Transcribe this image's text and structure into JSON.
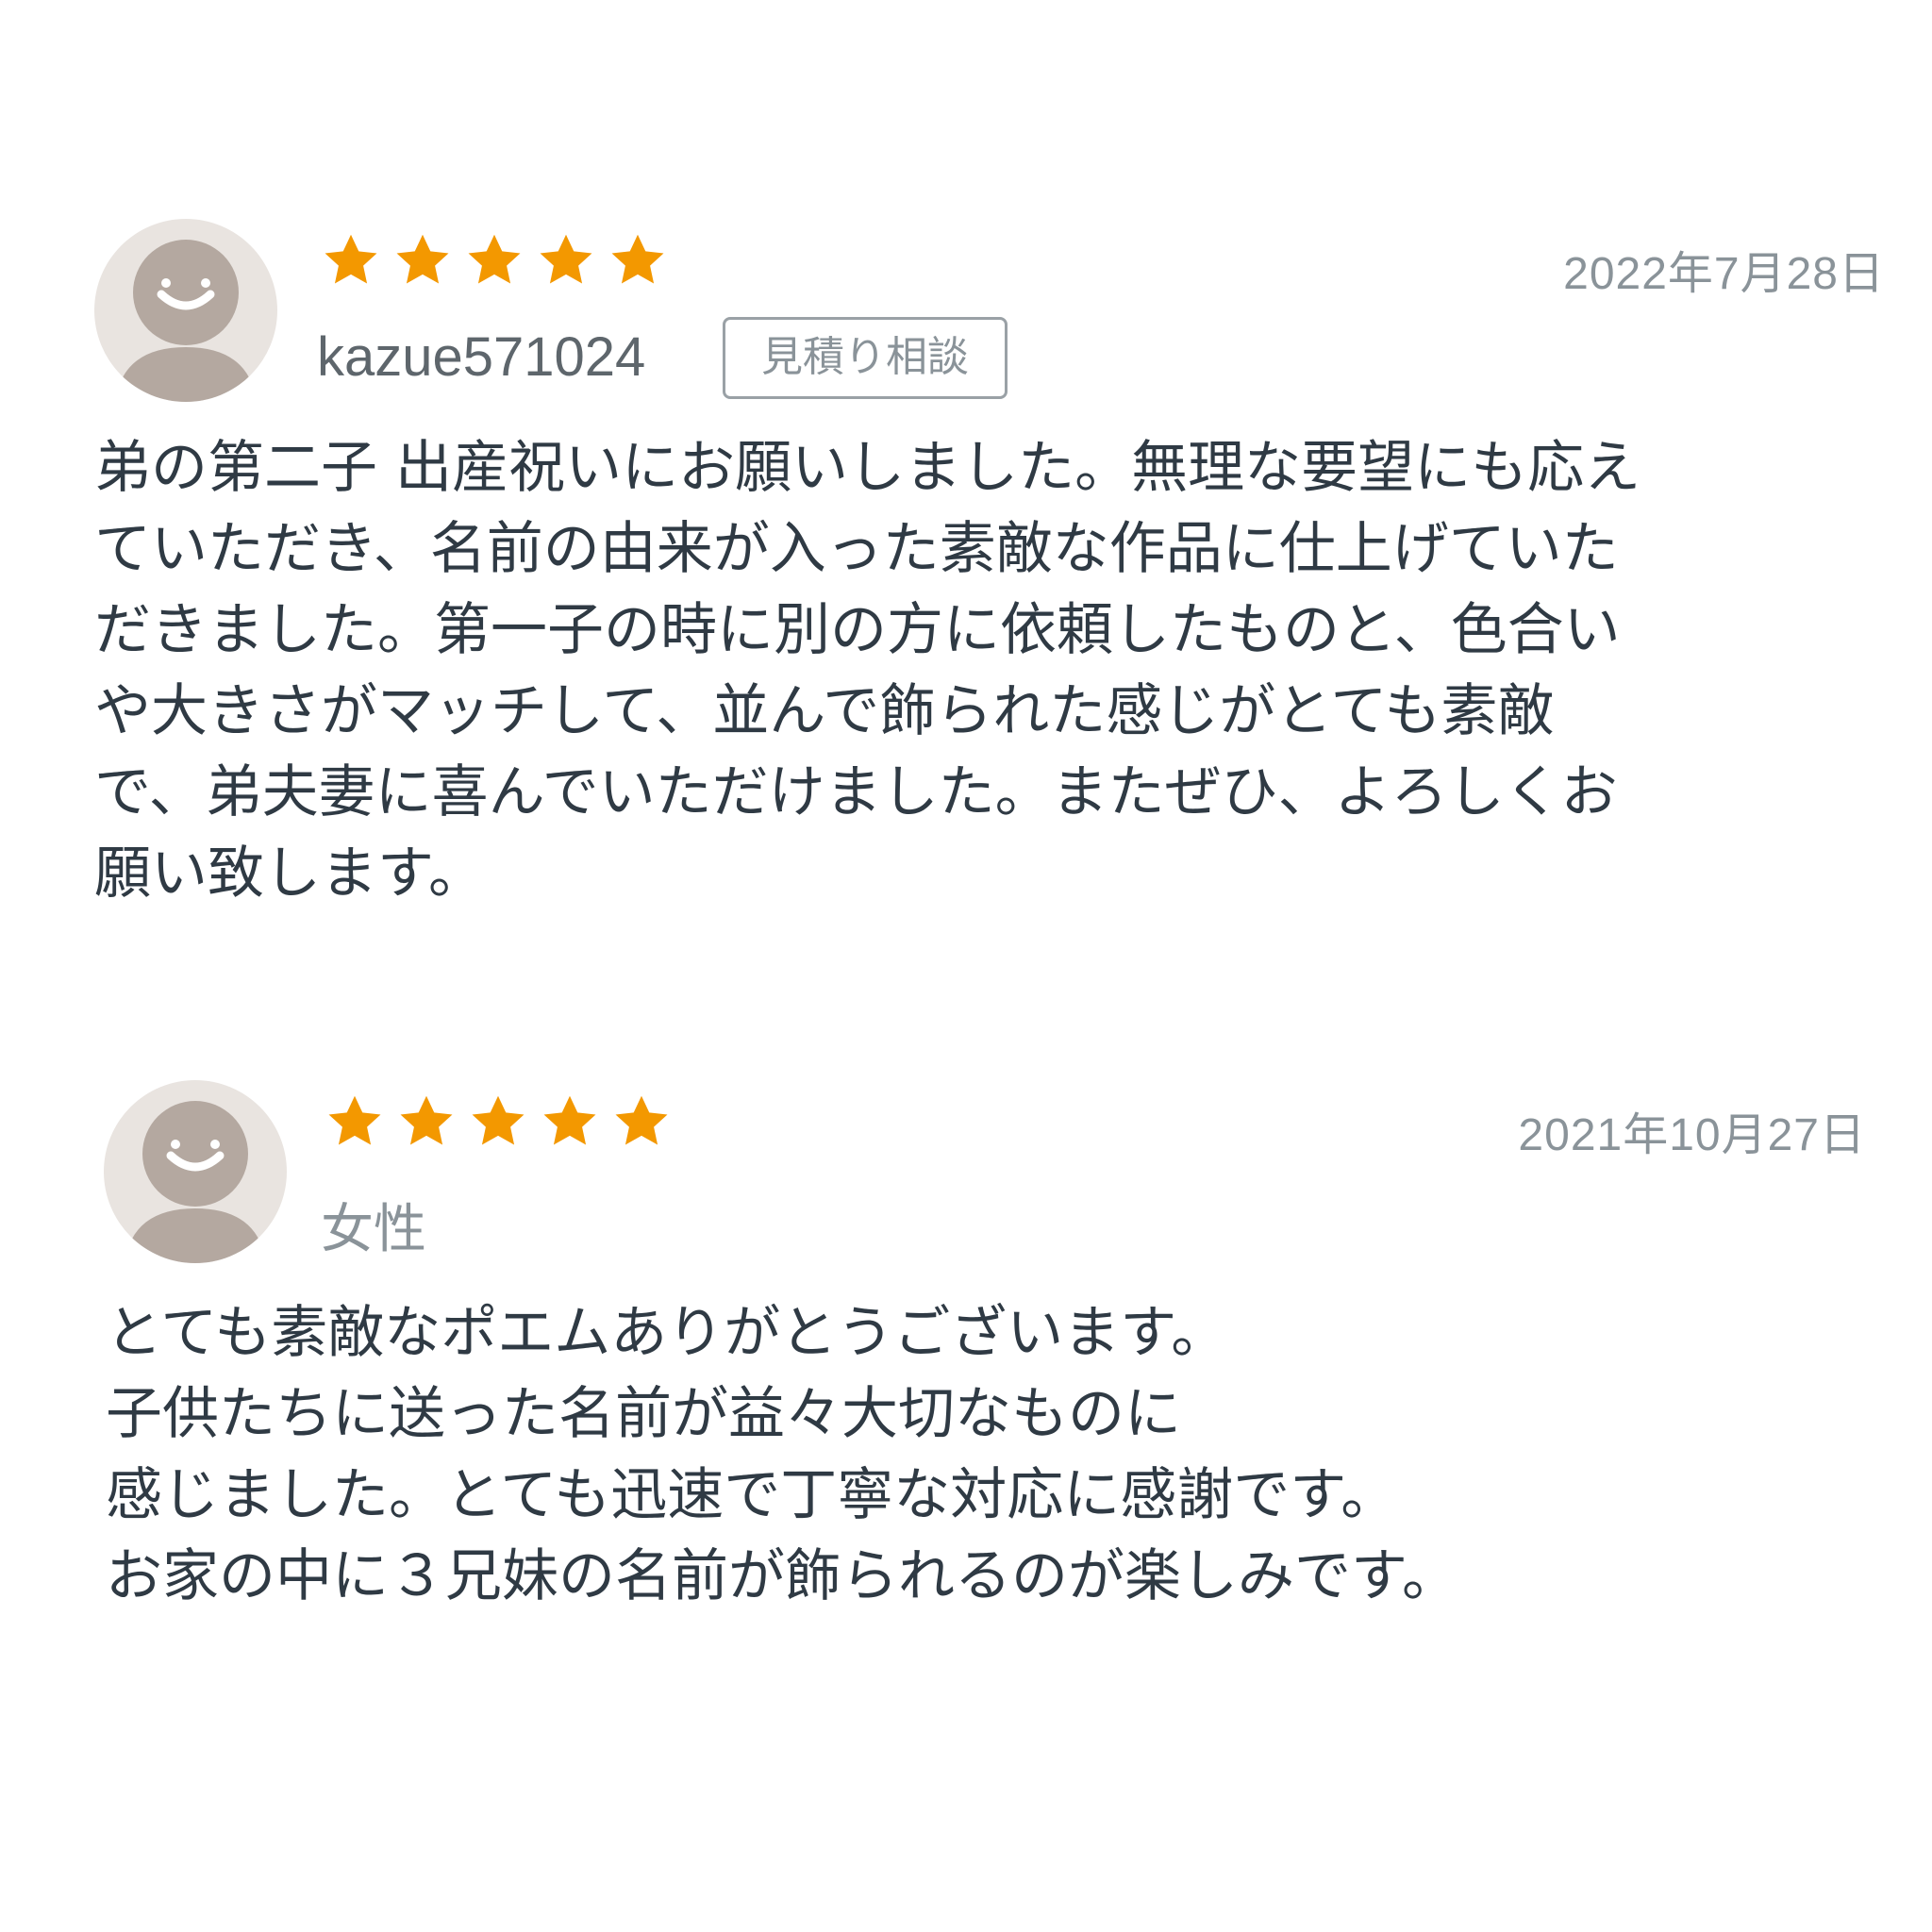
{
  "colors": {
    "star": "#f39800",
    "text": "#2f3a44",
    "muted": "#8a9399",
    "avatar_bg": "#e9e4e0",
    "avatar_fg": "#b4a8a0"
  },
  "reviews": [
    {
      "rating": 5,
      "date": "2022年7月28日",
      "reviewer": "kazue571024",
      "badge": "見積り相談",
      "avatar_icon": "default-user-avatar-icon",
      "body": "弟の第二子 出産祝いにお願いしました。無理な要望にも応え\nていただき、名前の由来が入った素敵な作品に仕上げていた\nだきました。第一子の時に別の方に依頼したものと、色合い\nや大きさがマッチして、並んで飾られた感じがとても素敵\nで、弟夫妻に喜んでいただけました。またぜひ、よろしくお\n願い致します。"
    },
    {
      "rating": 5,
      "date": "2021年10月27日",
      "reviewer": "女性",
      "avatar_icon": "default-user-avatar-icon",
      "body": "とても素敵なポエムありがとうございます。\n子供たちに送った名前が益々大切なものに\n感じました。とても迅速で丁寧な対応に感謝です。\nお家の中に３兄妹の名前が飾られるのが楽しみです。"
    }
  ]
}
